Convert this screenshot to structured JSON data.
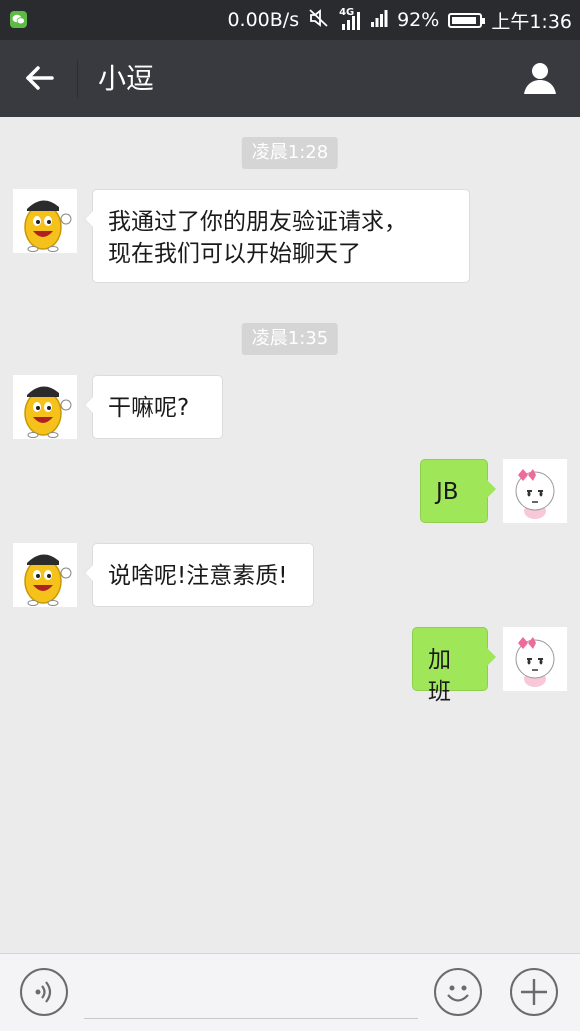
{
  "status_bar": {
    "network_speed": "0.00B/s",
    "network_type": "4G",
    "battery_percent": "92%",
    "battery_level": 0.92,
    "time": "上午1:36",
    "icons": [
      "wechat-notification-icon",
      "mute-icon",
      "4g-signal-icon",
      "signal-icon",
      "battery-icon"
    ]
  },
  "header": {
    "title": "小逗",
    "back_icon": "arrow-left-icon",
    "profile_icon": "person-icon"
  },
  "messages": [
    {
      "type": "timestamp",
      "text": "凌晨1:28"
    },
    {
      "type": "incoming",
      "text_lines": [
        "我通过了你的朋友验证请求，",
        "现在我们可以开始聊天了"
      ],
      "avatar": "yellow-bean-cartoon-avatar"
    },
    {
      "type": "timestamp",
      "text": "凌晨1:35"
    },
    {
      "type": "incoming",
      "text": "干嘛呢?",
      "avatar": "yellow-bean-cartoon-avatar"
    },
    {
      "type": "outgoing",
      "text": "JB",
      "avatar": "girl-with-bow-avatar"
    },
    {
      "type": "incoming",
      "text": "说啥呢!注意素质!",
      "avatar": "yellow-bean-cartoon-avatar"
    },
    {
      "type": "outgoing",
      "text": "加班",
      "avatar": "girl-with-bow-avatar"
    }
  ],
  "input_bar": {
    "voice_icon": "voice-icon",
    "emoji_icon": "emoji-icon",
    "plus_icon": "plus-icon",
    "placeholder": ""
  },
  "colors": {
    "status_bar_bg": "#2a2b2f",
    "title_bar_bg": "#393a3f",
    "chat_bg": "#ebebeb",
    "outgoing_bubble": "#9fe658",
    "incoming_bubble": "#ffffff",
    "timestamp_bg": "#d5d5d5"
  }
}
